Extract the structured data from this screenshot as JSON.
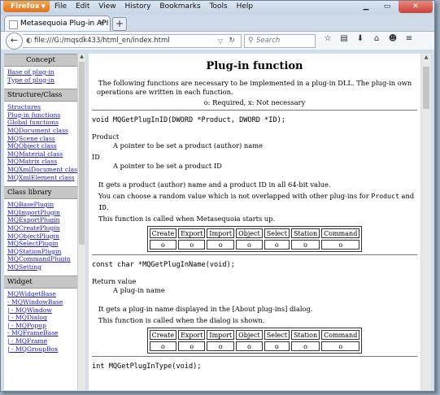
{
  "browser": {
    "app_button": "Firefox",
    "menu": [
      "File",
      "Edit",
      "View",
      "History",
      "Bookmarks",
      "Tools",
      "Help"
    ],
    "tab_title": "Metasequoia Plug-in API",
    "url": "file:///G:/mqsdk433/html_en/index.html",
    "search_placeholder": "Search"
  },
  "sidebar": {
    "sections": [
      {
        "title": "Concept",
        "items": [
          "Base of plug-in",
          "Type of plug-in"
        ]
      },
      {
        "title": "Structure/Class",
        "items": [
          "Structures",
          "Plug-in functions",
          "Global functions",
          "MQDocument class",
          "MQScene class",
          "MQObject class",
          "MQMaterial class",
          "MQMatrix class",
          "MQXmlDocument class",
          "MQXmlElement class"
        ]
      },
      {
        "title": "Class library",
        "items": [
          "MQBasePlugin",
          "MQImportPlugin",
          "MQExportPlugin",
          "MQCreatePlugin",
          "MQObjectPlugin",
          "MQSelectPlugin",
          "MQStationPlugin",
          "MQCommandPlugin",
          "MQSetting"
        ]
      },
      {
        "title": "Widget",
        "items": [
          "MQWidgetBase",
          "- MQWindowBase",
          "| - MQWindow",
          "| - MQDialog",
          "| - MQPopup",
          "- MQFrameBase",
          "| - MQFrame",
          "| - MQGroupBox"
        ]
      }
    ]
  },
  "main": {
    "title": "Plug-in function",
    "intro": "The following functions are necessary to be implemented in a plug-in DLL. The plug-in own operations are written in each function.",
    "legend": "o: Required, x: Not necessary",
    "table_headers": [
      "Create",
      "Export",
      "Import",
      "Object",
      "Select",
      "Station",
      "Command"
    ],
    "functions": [
      {
        "signature": "void MQGetPlugInID(DWORD *Product, DWORD *ID);",
        "params": [
          {
            "name": "Product",
            "desc": "A pointer to be set a product (author) name"
          },
          {
            "name": "ID",
            "desc": "A pointer to be set a product ID"
          }
        ],
        "desc1": "It gets a product (author) name and a product ID in all 64-bit value.",
        "desc2_pre": "You can choose a random value which is not overlapped with other plug-ins for ",
        "desc2_code1": "Product",
        "desc2_and": " and ",
        "desc2_code2": "ID",
        "desc2_end": ".",
        "desc3": "This function is called when Metasequoia starts up.",
        "row": [
          "o",
          "o",
          "o",
          "o",
          "o",
          "o",
          "o"
        ]
      },
      {
        "signature": "const char *MQGetPlugInName(void);",
        "return_label": "Return value",
        "return_desc": "A plug-in name",
        "desc1": "It gets a plug-in name displayed in the [About plug-ins] dialog.",
        "desc2": "This function is called when the dialog is shown.",
        "row": [
          "o",
          "o",
          "o",
          "o",
          "o",
          "o",
          "o"
        ]
      },
      {
        "signature": "int MQGetPlugInType(void);"
      }
    ]
  }
}
